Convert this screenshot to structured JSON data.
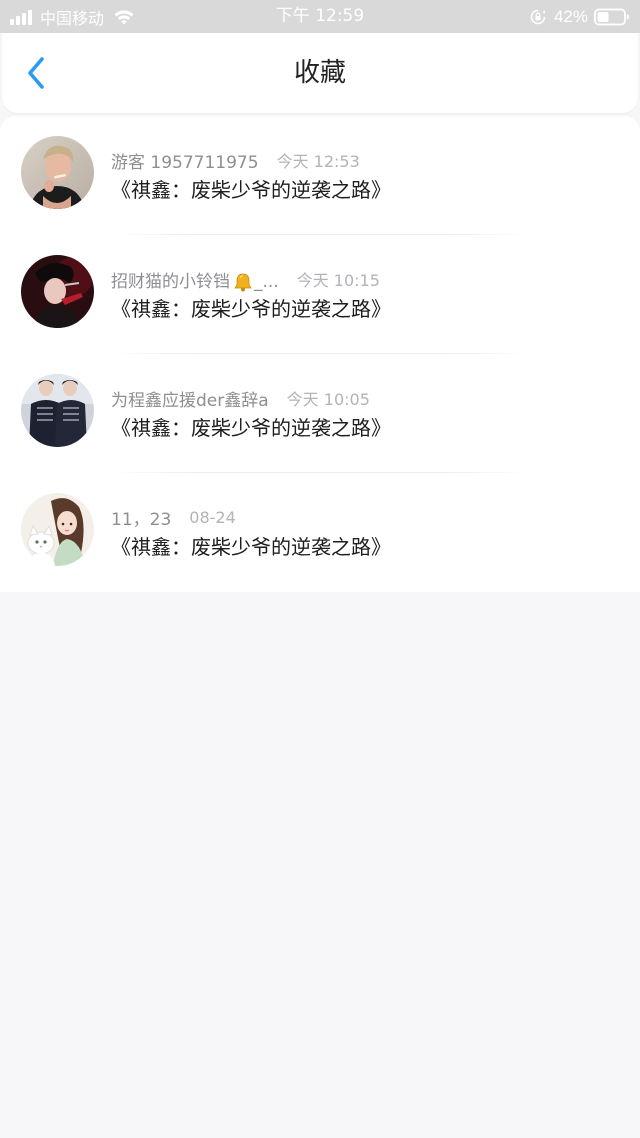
{
  "status_bar": {
    "carrier": "中国移动",
    "time": "下午 12:59",
    "battery": "42%"
  },
  "header": {
    "title": "收藏",
    "back_icon": "chevron-left-icon"
  },
  "colors": {
    "accent": "#2b9af3",
    "username": "#8e8e93",
    "timestamp": "#b3b3b8",
    "title_text": "#1e1e1e",
    "background": "#f7f6f9"
  },
  "favorites": [
    {
      "username": "游客 1957711975",
      "time": "今天 12:53",
      "book": "《祺鑫：废柴少爷的逆袭之路》"
    },
    {
      "username": "招财猫的小铃铛",
      "username_suffix": "_...",
      "time": "今天 10:15",
      "book": "《祺鑫：废柴少爷的逆袭之路》"
    },
    {
      "username": "为程鑫应援der鑫辞a",
      "time": "今天 10:05",
      "book": "《祺鑫：废柴少爷的逆袭之路》"
    },
    {
      "username": "11，23",
      "time": "08-24",
      "book": "《祺鑫：废柴少爷的逆袭之路》"
    }
  ]
}
